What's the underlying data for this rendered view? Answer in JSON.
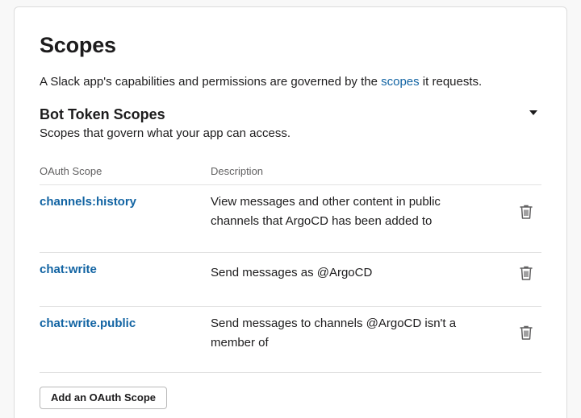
{
  "page": {
    "title": "Scopes",
    "intro_before": "A Slack app's capabilities and permissions are governed by the ",
    "intro_link": "scopes",
    "intro_after": " it requests."
  },
  "section": {
    "title": "Bot Token Scopes",
    "description": "Scopes that govern what your app can access.",
    "toggle_icon": "caret-down-icon"
  },
  "table": {
    "headers": {
      "scope": "OAuth Scope",
      "description": "Description"
    },
    "rows": [
      {
        "scope": "channels:history",
        "description": "View messages and other content in public channels that ArgoCD has been added to",
        "action_icon": "trash-icon"
      },
      {
        "scope": "chat:write",
        "description": "Send messages as @ArgoCD",
        "action_icon": "trash-icon"
      },
      {
        "scope": "chat:write.public",
        "description": "Send messages to channels @ArgoCD isn't a member of",
        "action_icon": "trash-icon"
      }
    ]
  },
  "actions": {
    "add_scope_label": "Add an OAuth Scope"
  },
  "colors": {
    "link": "#1264a3",
    "text": "#1d1c1d",
    "muted": "#616061",
    "divider": "#e2e2e2"
  }
}
